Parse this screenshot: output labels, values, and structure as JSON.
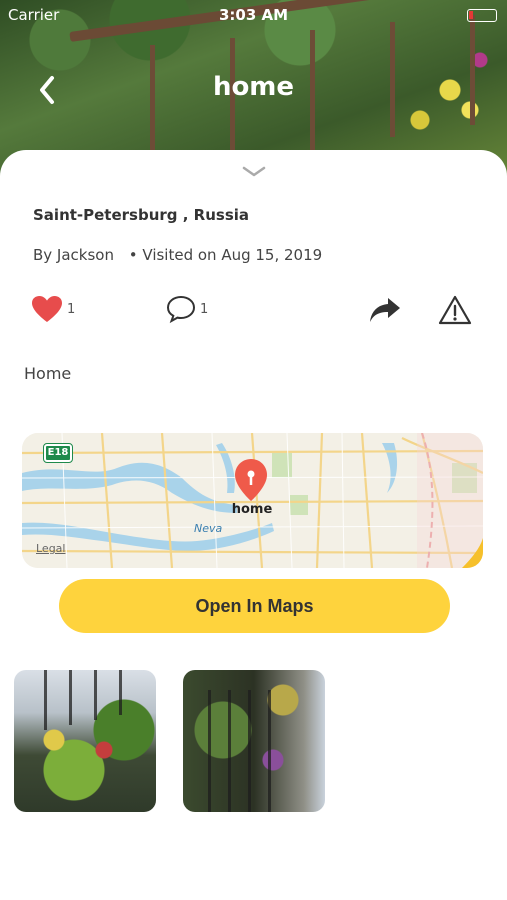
{
  "status_bar": {
    "carrier": "Carrier",
    "time": "3:03 AM"
  },
  "header": {
    "title": "home",
    "back_icon": "chevron-left-icon"
  },
  "post": {
    "location": "Saint-Petersburg , Russia",
    "author": "By Jackson",
    "visited": "• Visited on Aug 15, 2019",
    "description": "Home",
    "likes": "1",
    "comments": "1"
  },
  "icons": {
    "like": "heart-icon",
    "comment": "comment-bubble-icon",
    "share": "share-arrow-icon",
    "report": "warning-triangle-icon",
    "handle": "chevron-down-icon"
  },
  "map": {
    "pin_label": "home",
    "legal": "Legal",
    "route_badge": "E18",
    "river_label": "Neva"
  },
  "buttons": {
    "open_maps": "Open In Maps"
  },
  "colors": {
    "accent": "#fed33d",
    "heart": "#e74c4c",
    "pin": "#ef5a4a"
  }
}
